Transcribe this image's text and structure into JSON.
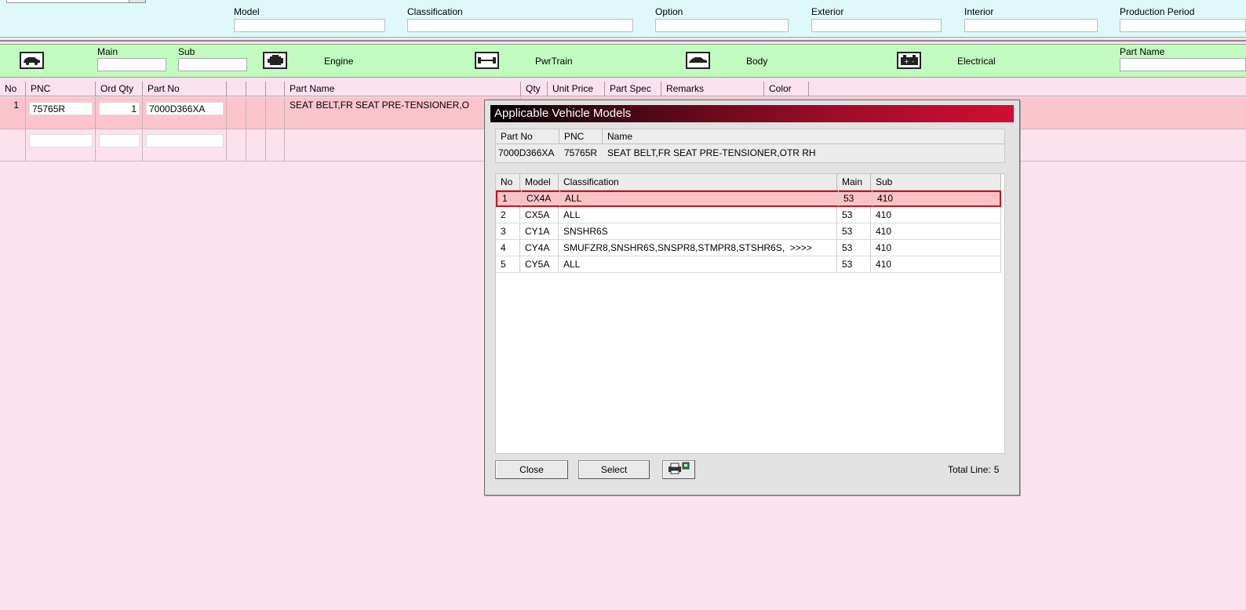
{
  "filters": {
    "model_label": "Model",
    "classification_label": "Classification",
    "option_label": "Option",
    "exterior_label": "Exterior",
    "interior_label": "Interior",
    "production_period_label": "Production Period"
  },
  "categories": {
    "main_label": "Main",
    "sub_label": "Sub",
    "engine": "Engine",
    "pwrtrain": "PwrTrain",
    "body": "Body",
    "electrical": "Electrical",
    "part_name_label": "Part Name",
    "icons": [
      "car-icon",
      "engine-icon",
      "powertrain-icon",
      "body-icon",
      "battery-icon"
    ]
  },
  "grid": {
    "headers": [
      "No",
      "PNC",
      "Ord Qty",
      "Part No",
      "",
      "",
      "",
      "Part Name",
      "Qty",
      "Unit Price",
      "Part Spec",
      "Remarks",
      "Color"
    ],
    "rows": [
      {
        "no": "1",
        "pnc": "75765R",
        "ord_qty": "1",
        "part_no": "7000D366XA",
        "part_name": "SEAT BELT,FR SEAT PRE-TENSIONER,O"
      }
    ]
  },
  "dialog": {
    "title": "Applicable Vehicle Models",
    "info_headers": [
      "Part No",
      "PNC",
      "Name"
    ],
    "info_values": {
      "part_no": "7000D366XA",
      "pnc": "75765R",
      "name": "SEAT BELT,FR SEAT PRE-TENSIONER,OTR RH"
    },
    "list_headers": [
      "No",
      "Model",
      "Classification",
      "Main",
      "Sub"
    ],
    "rows": [
      {
        "no": "1",
        "model": "CX4A",
        "classification": "ALL",
        "main": "53",
        "sub": "410"
      },
      {
        "no": "2",
        "model": "CX5A",
        "classification": "ALL",
        "main": "53",
        "sub": "410"
      },
      {
        "no": "3",
        "model": "CY1A",
        "classification": "SNSHR6S",
        "main": "53",
        "sub": "410"
      },
      {
        "no": "4",
        "model": "CY4A",
        "classification": "SMUFZR8,SNSHR6S,SNSPR8,STMPR8,STSHR6S,  >>>>",
        "main": "53",
        "sub": "410"
      },
      {
        "no": "5",
        "model": "CY5A",
        "classification": "ALL",
        "main": "53",
        "sub": "410"
      }
    ],
    "close_label": "Close",
    "select_label": "Select",
    "print_icon": "printer-icon",
    "total_label": "Total Line:",
    "total_value": "5"
  },
  "colors": {
    "background": "#fde2ee",
    "filter_bar": "#dff9fb",
    "category_bar": "#c2fbc0",
    "selected_row": "#fcc4cd",
    "dialog_title": "#d10d35",
    "selected_highlight": "#c8141e"
  }
}
